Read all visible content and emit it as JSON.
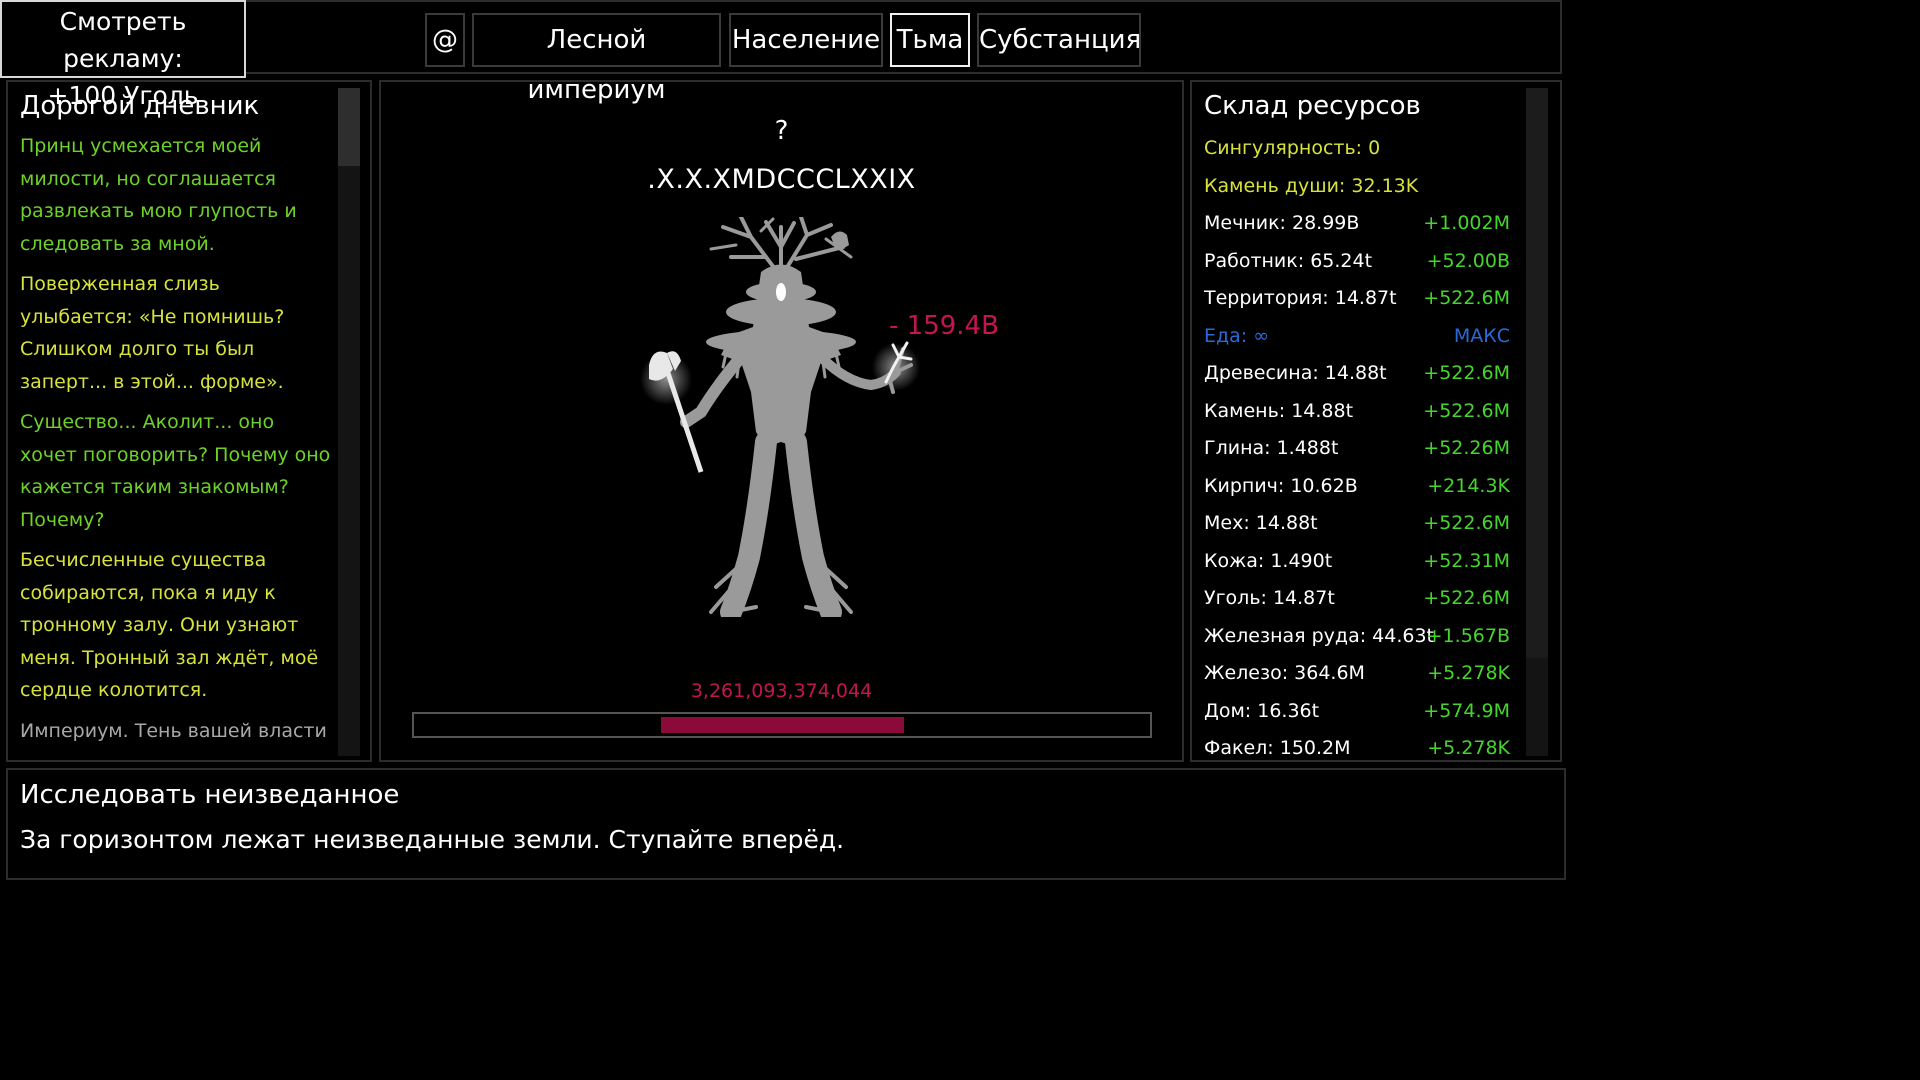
{
  "ad": {
    "line1": "Смотреть рекламу:",
    "line2": "+100 Уголь"
  },
  "tabs": [
    {
      "label": "@"
    },
    {
      "label": "Лесной империум"
    },
    {
      "label": "Население"
    },
    {
      "label": "Тьма"
    },
    {
      "label": "Субстанция"
    }
  ],
  "active_tab": "Тьма",
  "diary": {
    "title": "Дорогой дневник",
    "entries": [
      {
        "text": "Принц усмехается моей милости, но соглашается развлекать мою глупость и следовать за мной.",
        "color": "#6ed12a"
      },
      {
        "text": "Поверженная слизь улыбается: «Не помнишь? Слишком долго ты был заперт... в этой... форме».",
        "color": "#d7e23c"
      },
      {
        "text": "Существо... Аколит... оно хочет поговорить? Почему оно кажется таким знакомым? Почему?",
        "color": "#6ed12a"
      },
      {
        "text": "Бесчисленные существа собираются, пока я иду к тронному залу. Они узнают меня. Тронный зал ждёт, моё сердце колотится.",
        "color": "#d7e23c"
      },
      {
        "text": "Империум. Тень вашей власти",
        "color": "#a8a8a8"
      }
    ]
  },
  "battle": {
    "question_mark": "?",
    "enemy_name": ".X.X.XMDCCCLXXIX",
    "damage_text": "- 159.4B",
    "hp_text": "3,261,093,374,044",
    "hp_fraction": 0.33,
    "creature_icon": "treant-creature-icon",
    "colors": {
      "damage": "#c41553",
      "hp_fill": "#8c0a3a"
    }
  },
  "resources": {
    "title": "Склад ресурсов",
    "items": [
      {
        "label": "Сингулярность: 0",
        "rate": "",
        "color": "#d7e23c",
        "rate_color": "#45d62c"
      },
      {
        "label": "Камень души: 32.13K",
        "rate": "",
        "color": "#d7e23c",
        "rate_color": "#45d62c"
      },
      {
        "label": "Мечник: 28.99B",
        "rate": "+1.002M",
        "color": "#ffffff",
        "rate_color": "#45d62c"
      },
      {
        "label": "Работник: 65.24t",
        "rate": "+52.00B",
        "color": "#ffffff",
        "rate_color": "#45d62c"
      },
      {
        "label": "Территория: 14.87t",
        "rate": "+522.6M",
        "color": "#ffffff",
        "rate_color": "#45d62c"
      },
      {
        "label": "Еда: ∞",
        "rate": "МАКС",
        "color": "#2a6ad8",
        "rate_color": "#2a6ad8"
      },
      {
        "label": "Древесина: 14.88t",
        "rate": "+522.6M",
        "color": "#ffffff",
        "rate_color": "#45d62c"
      },
      {
        "label": "Камень: 14.88t",
        "rate": "+522.6M",
        "color": "#ffffff",
        "rate_color": "#45d62c"
      },
      {
        "label": "Глина: 1.488t",
        "rate": "+52.26M",
        "color": "#ffffff",
        "rate_color": "#45d62c"
      },
      {
        "label": "Кирпич: 10.62B",
        "rate": "+214.3K",
        "color": "#ffffff",
        "rate_color": "#45d62c"
      },
      {
        "label": "Мех: 14.88t",
        "rate": "+522.6M",
        "color": "#ffffff",
        "rate_color": "#45d62c"
      },
      {
        "label": "Кожа: 1.490t",
        "rate": "+52.31M",
        "color": "#ffffff",
        "rate_color": "#45d62c"
      },
      {
        "label": "Уголь: 14.87t",
        "rate": "+522.6M",
        "color": "#ffffff",
        "rate_color": "#45d62c"
      },
      {
        "label": "Железная руда: 44.63t",
        "rate": "+1.567B",
        "color": "#ffffff",
        "rate_color": "#45d62c"
      },
      {
        "label": "Железо: 364.6M",
        "rate": "+5.278K",
        "color": "#ffffff",
        "rate_color": "#45d62c"
      },
      {
        "label": "Дом: 16.36t",
        "rate": "+574.9M",
        "color": "#ffffff",
        "rate_color": "#45d62c"
      },
      {
        "label": "Факел: 150.2M",
        "rate": "+5.278K",
        "color": "#ffffff",
        "rate_color": "#45d62c"
      }
    ]
  },
  "explore": {
    "title": "Исследовать неизведанное",
    "description": "За горизонтом лежат неизведанные земли. Ступайте вперёд."
  }
}
